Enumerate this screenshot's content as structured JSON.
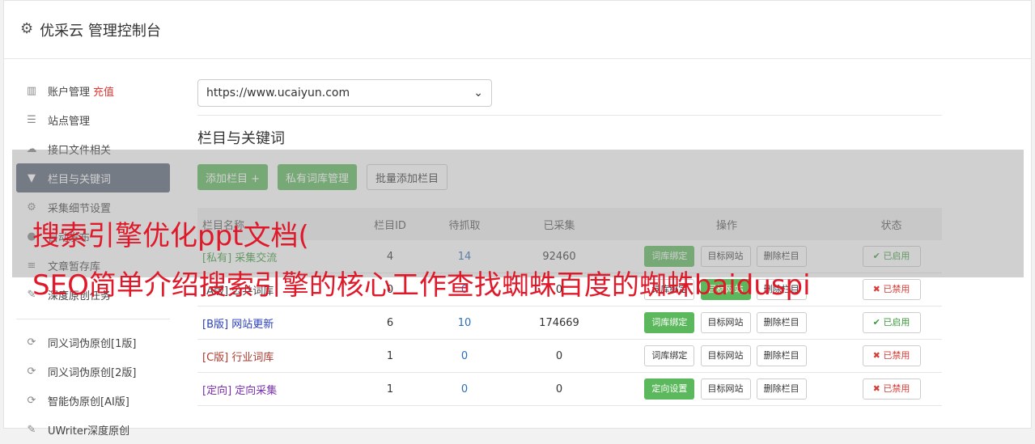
{
  "header": {
    "title": "优采云 管理控制台"
  },
  "sidebar": {
    "items": [
      {
        "label": "账户管理",
        "extra": "充值"
      },
      {
        "label": "站点管理"
      },
      {
        "label": "接口文件相关"
      },
      {
        "label": "栏目与关键词"
      },
      {
        "label": "采集细节设置"
      },
      {
        "label": "自动发布"
      },
      {
        "label": "文章暂存库"
      },
      {
        "label": "深度原创任务"
      }
    ],
    "items2": [
      {
        "label": "同义词伪原创[1版]"
      },
      {
        "label": "同义词伪原创[2版]"
      },
      {
        "label": "智能伪原创[AI版]"
      },
      {
        "label": "UWriter深度原创"
      }
    ]
  },
  "main": {
    "site_select": "https://www.ucaiyun.com",
    "section_title": "栏目与关键词",
    "buttons": {
      "add_column": "添加栏目 +",
      "private_lib": "私有词库管理",
      "batch_add": "批量添加栏目"
    }
  },
  "table": {
    "headers": [
      "栏目名称",
      "栏目ID",
      "待抓取",
      "已采集",
      "操作",
      "状态"
    ],
    "rows": [
      {
        "tag": "[私有]",
        "name": "采集交流",
        "id": "4",
        "pending": "14",
        "collected": "92460",
        "action1": "词库绑定",
        "action2": "目标网站",
        "action3": "删除栏目",
        "status": "已启用"
      },
      {
        "tag": "[A版]",
        "name": "公共词库",
        "id": "0",
        "pending": "0",
        "collected": "0",
        "action1": "词库绑定",
        "action2": "目标网站",
        "action3": "删除栏目",
        "status": "已禁用"
      },
      {
        "tag": "[B版]",
        "name": "网站更新",
        "id": "6",
        "pending": "10",
        "collected": "174669",
        "action1": "词库绑定",
        "action2": "目标网站",
        "action3": "删除栏目",
        "status": "已启用"
      },
      {
        "tag": "[C版]",
        "name": "行业词库",
        "id": "1",
        "pending": "0",
        "collected": "0",
        "action1": "词库绑定",
        "action2": "目标网站",
        "action3": "删除栏目",
        "status": "已禁用"
      },
      {
        "tag": "[定向]",
        "name": "定向采集",
        "id": "1",
        "pending": "0",
        "collected": "0",
        "action1": "定向设置",
        "action2": "目标网站",
        "action3": "删除栏目",
        "status": "已禁用"
      }
    ]
  },
  "overlay": {
    "line1": "搜索引擎优化ppt文档(",
    "line2": "SEO简单介绍搜索引擎的核心工作查找蜘蛛百度的蜘蛛baiduspi"
  },
  "colors": {
    "green": "#5cb85c",
    "active_bg": "#5a6577",
    "red": "#e0192a",
    "blue": "#2a6ebb"
  },
  "icons": {
    "header": "gear-icon",
    "status_on": "check-icon",
    "status_off": "x-icon"
  }
}
